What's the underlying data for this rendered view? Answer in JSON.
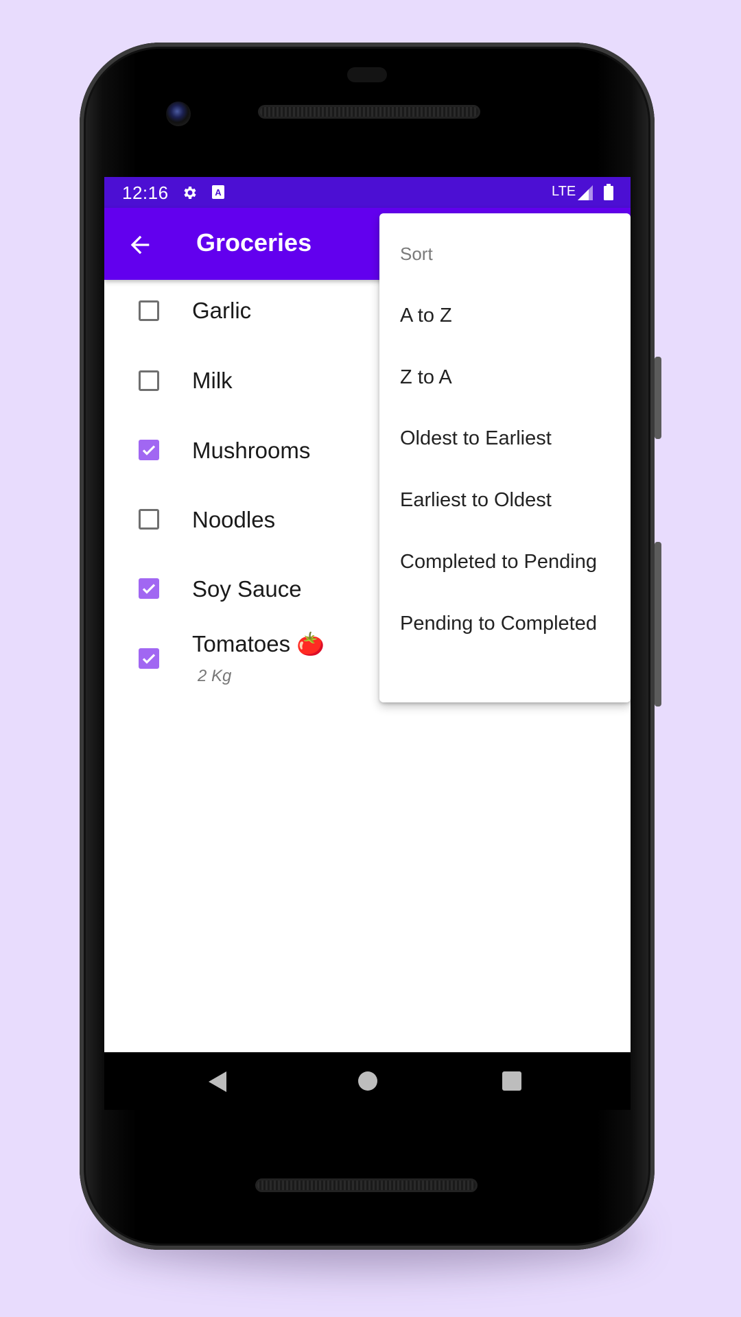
{
  "status_bar": {
    "time": "12:16",
    "network": "LTE",
    "icons": [
      "settings-icon",
      "a-icon",
      "signal-icon",
      "battery-icon"
    ]
  },
  "app_bar": {
    "title": "Groceries",
    "back_icon": "arrow-left-icon"
  },
  "items": [
    {
      "label": "Garlic",
      "checked": false
    },
    {
      "label": "Milk",
      "checked": false
    },
    {
      "label": "Mushrooms",
      "checked": true
    },
    {
      "label": "Noodles",
      "checked": false
    },
    {
      "label": "Soy Sauce",
      "checked": true
    },
    {
      "label": "Tomatoes 🍅",
      "checked": true,
      "note": "2 Kg"
    }
  ],
  "sort_menu": {
    "header": "Sort",
    "options": [
      "A to Z",
      "Z to A",
      "Oldest to Earliest",
      "Earliest to Oldest",
      "Completed to Pending",
      "Pending to Completed"
    ]
  },
  "nav_bar": {
    "icons": [
      "nav-back-icon",
      "nav-home-icon",
      "nav-recents-icon"
    ]
  },
  "colors": {
    "background": "#e8dcfd",
    "status_bar": "#4c0fd3",
    "app_bar": "#6200ee",
    "checkbox_checked": "#a167f2"
  }
}
